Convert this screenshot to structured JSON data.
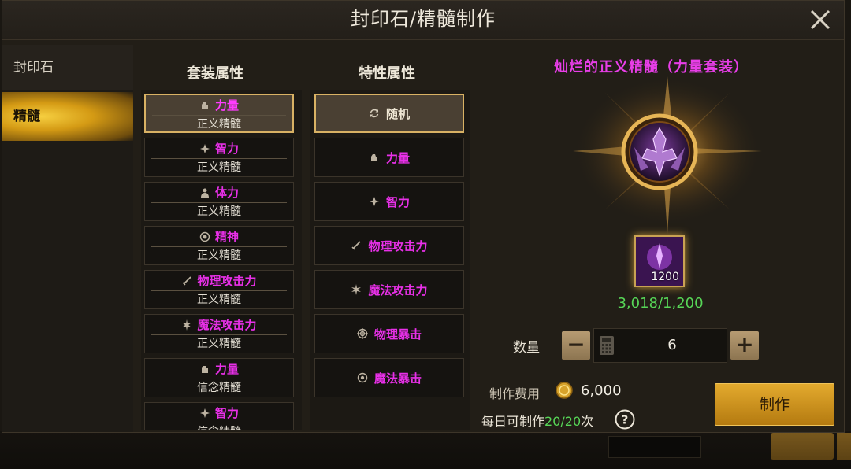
{
  "window": {
    "title": "封印石/精髓制作",
    "close_icon": "close-icon"
  },
  "sidebar": {
    "tabs": [
      {
        "label": "封印石",
        "selected": false
      },
      {
        "label": "精髓",
        "selected": true
      }
    ]
  },
  "columns": {
    "set_header": "套装属性",
    "trait_header": "特性属性"
  },
  "set_list": [
    {
      "name": "力量",
      "type": "正义精髓",
      "icon": "fist-icon",
      "selected": true
    },
    {
      "name": "智力",
      "type": "正义精髓",
      "icon": "magic-star-icon",
      "selected": false
    },
    {
      "name": "体力",
      "type": "正义精髓",
      "icon": "body-icon",
      "selected": false
    },
    {
      "name": "精神",
      "type": "正义精髓",
      "icon": "spirit-orb-icon",
      "selected": false
    },
    {
      "name": "物理攻击力",
      "type": "正义精髓",
      "icon": "sword-icon",
      "selected": false
    },
    {
      "name": "魔法攻击力",
      "type": "正义精髓",
      "icon": "magic-burst-icon",
      "selected": false
    },
    {
      "name": "力量",
      "type": "信念精髓",
      "icon": "fist-icon",
      "selected": false
    },
    {
      "name": "智力",
      "type": "信念精髓",
      "icon": "magic-star-icon",
      "selected": false
    }
  ],
  "trait_list": [
    {
      "name": "随机",
      "icon": "refresh-icon",
      "selected": true
    },
    {
      "name": "力量",
      "icon": "fist-icon",
      "selected": false
    },
    {
      "name": "智力",
      "icon": "magic-star-icon",
      "selected": false
    },
    {
      "name": "物理攻击力",
      "icon": "sword-icon",
      "selected": false
    },
    {
      "name": "魔法攻击力",
      "icon": "magic-burst-icon",
      "selected": false
    },
    {
      "name": "物理暴击",
      "icon": "crosshair-icon",
      "selected": false
    },
    {
      "name": "魔法暴击",
      "icon": "target-icon",
      "selected": false
    }
  ],
  "product": {
    "title": "灿烂的正义精髓（力量套装）",
    "material_qty": "1200",
    "material_count": "3,018/1,200"
  },
  "quantity": {
    "label": "数量",
    "value": "6",
    "minus": "−",
    "plus": "+"
  },
  "cost": {
    "label": "制作费用",
    "value": "6,000"
  },
  "daily": {
    "prefix": "每日可制作",
    "count": "20/20",
    "suffix": "次"
  },
  "craft_button": "制作",
  "colors": {
    "accent_gold": "#d8b164",
    "purple_text": "#e830e8",
    "green_text": "#57d657"
  }
}
